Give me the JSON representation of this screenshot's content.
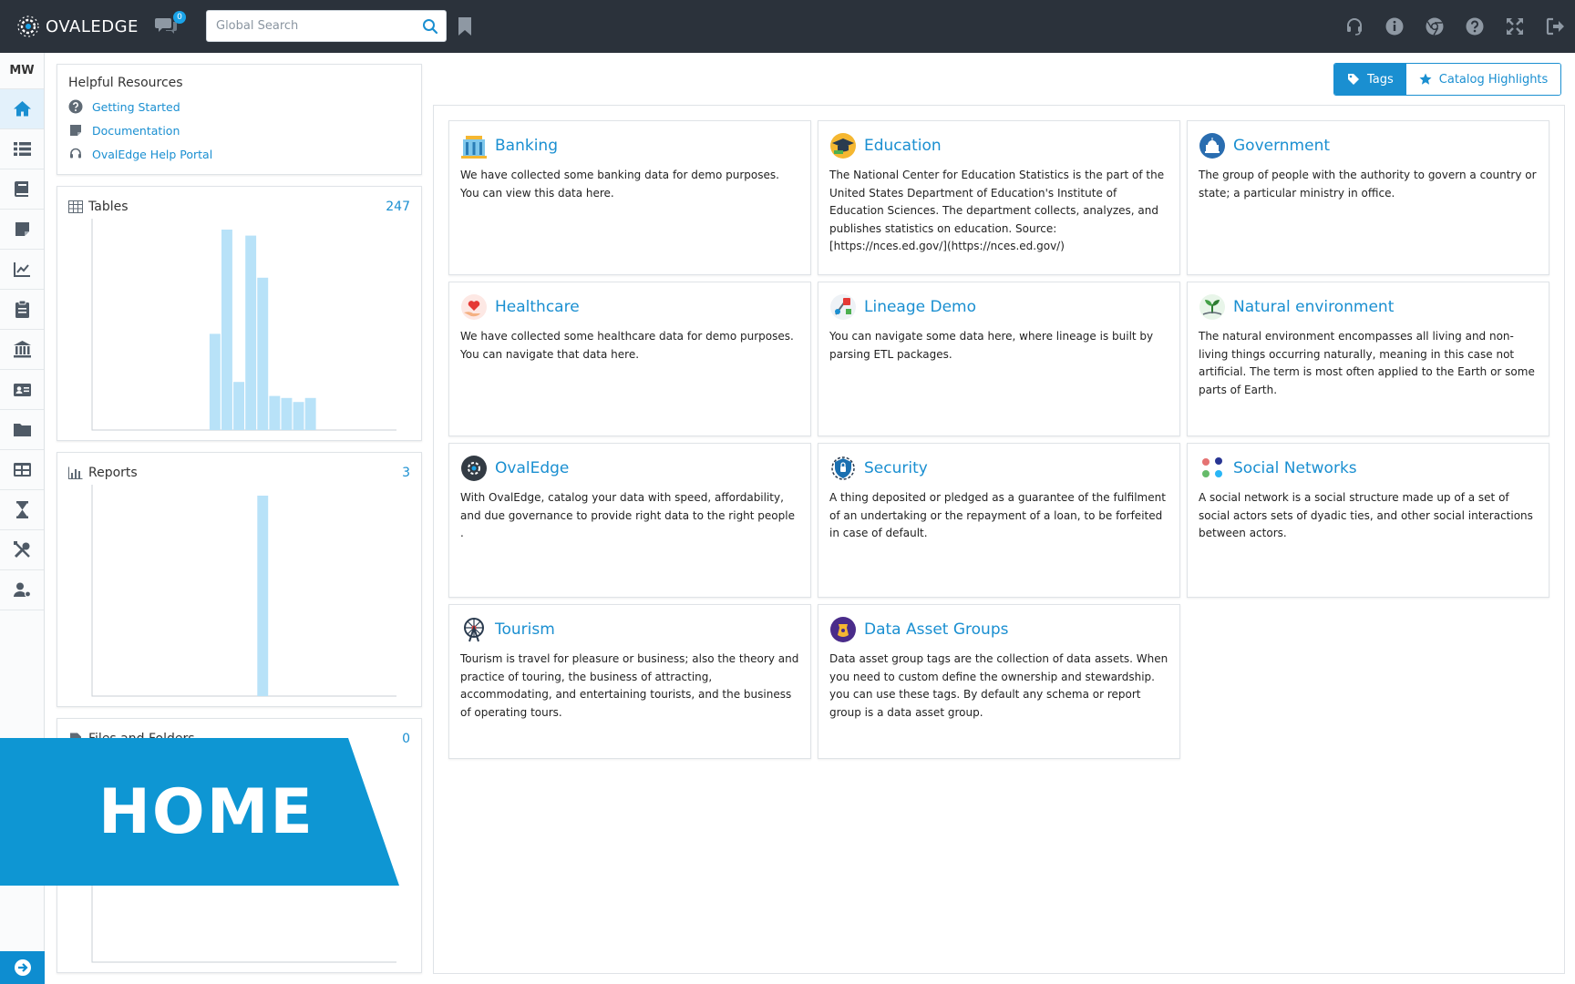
{
  "header": {
    "logo_text": "OVALEDGE",
    "chat_badge": "0",
    "search_placeholder": "Global Search",
    "icons": [
      "headset-icon",
      "info-icon",
      "chrome-icon",
      "help-icon",
      "expand-icon",
      "logout-icon"
    ]
  },
  "leftnav": {
    "avatar": "MW",
    "items": [
      "home-icon",
      "list-icon",
      "book-icon",
      "note-icon",
      "chart-line-icon",
      "clipboard-icon",
      "bank-icon",
      "id-card-icon",
      "folder-icon",
      "table-icon",
      "hourglass-icon",
      "tools-icon",
      "user-gear-icon"
    ]
  },
  "resources": {
    "title": "Helpful Resources",
    "links": [
      {
        "label": "Getting Started",
        "icon": "question-circle-icon"
      },
      {
        "label": "Documentation",
        "icon": "doc-icon"
      },
      {
        "label": "OvalEdge Help Portal",
        "icon": "headset-icon"
      }
    ]
  },
  "stats": {
    "tables": {
      "label": "Tables",
      "count": "247"
    },
    "reports": {
      "label": "Reports",
      "count": "3"
    },
    "files": {
      "label": "Files and Folders",
      "count": "0"
    }
  },
  "chart_data": [
    {
      "type": "bar",
      "title": "Tables",
      "values": [
        0,
        0,
        0,
        0,
        0,
        0,
        0,
        0,
        0,
        48,
        100,
        24,
        97,
        76,
        17,
        16,
        14,
        16,
        0,
        0,
        0,
        0,
        0,
        0,
        0,
        0
      ],
      "color": "#b8e2f8"
    },
    {
      "type": "bar",
      "title": "Reports",
      "values": [
        0,
        0,
        0,
        0,
        0,
        0,
        0,
        0,
        0,
        0,
        0,
        0,
        0,
        100,
        0,
        0,
        0,
        0,
        0,
        0,
        0,
        0,
        0,
        0,
        0,
        0
      ],
      "color": "#b8e2f8"
    }
  ],
  "banner": {
    "text": "HOME",
    "color": "#0e96d3"
  },
  "toggle": {
    "tags": "Tags",
    "highlights": "Catalog Highlights"
  },
  "cards": [
    {
      "title": "Banking",
      "icon": "bank-building-icon",
      "desc": "We have collected some banking data for demo purposes. You can view this data here."
    },
    {
      "title": "Education",
      "icon": "graduation-icon",
      "desc": "The National Center for Education Statistics is the part of the United States Department of Education's Institute of Education Sciences. The department collects, analyzes, and publishes statistics on education. Source: [https://nces.ed.gov/](https://nces.ed.gov/)"
    },
    {
      "title": "Government",
      "icon": "capitol-icon",
      "desc": "The group of people with the authority to govern a country or state; a particular ministry in office."
    },
    {
      "title": "Healthcare",
      "icon": "heart-hand-icon",
      "desc": "We have collected some healthcare data for demo purposes. You can navigate that data here."
    },
    {
      "title": "Lineage Demo",
      "icon": "lineage-icon",
      "desc": "You can navigate some data here, where lineage is built by parsing ETL packages."
    },
    {
      "title": "Natural environment",
      "icon": "plant-icon",
      "desc": "The natural environment encompasses all living and non-living things occurring naturally, meaning in this case not artificial. The term is most often applied to the Earth or some parts of Earth."
    },
    {
      "title": "OvalEdge",
      "icon": "ovaledge-logo-icon",
      "desc": "With OvalEdge, catalog your data with speed, affordability, and due governance to provide right data to the right people ."
    },
    {
      "title": "Security",
      "icon": "shield-icon",
      "desc": "A thing deposited or pledged as a guarantee of the fulfilment of an undertaking or the repayment of a loan, to be forfeited in case of default."
    },
    {
      "title": "Social Networks",
      "icon": "social-network-icon",
      "desc": "A social network is a social structure made up of a set of social actors sets of dyadic ties, and other social interactions between actors."
    },
    {
      "title": "Tourism",
      "icon": "ferris-wheel-icon",
      "desc": "Tourism is travel for pleasure or business; also the theory and practice of touring, the business of attracting, accommodating, and entertaining tourists, and the business of operating tours."
    },
    {
      "title": "Data Asset Groups",
      "icon": "data-asset-icon",
      "desc": "Data asset group tags are the collection of data assets. When you need to custom define the ownership and stewardship. you can use these tags. By default any schema or report group is a data asset group."
    }
  ]
}
